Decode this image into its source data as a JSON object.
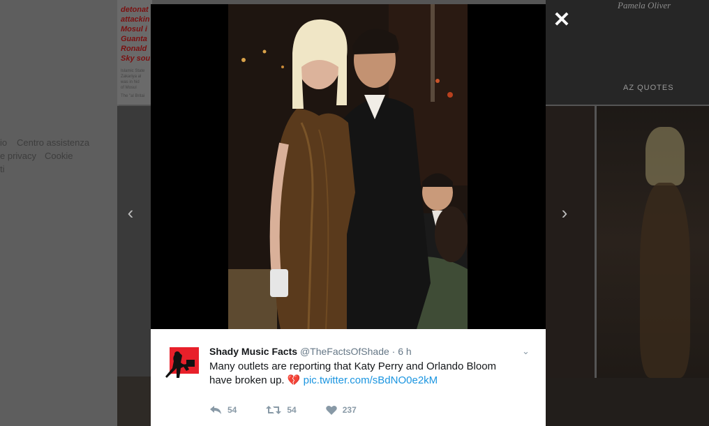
{
  "background": {
    "news_lines": [
      "detonat",
      "attackin",
      "Mosul i",
      "Guanta",
      "Ronald",
      "Sky sou"
    ],
    "news_small": [
      "Islamic State",
      "Zakariya al",
      "was in hid",
      "of Mosul",
      "The \"al Britai"
    ],
    "footer_links": [
      "io",
      "Centro assistenza",
      "e privacy",
      "Cookie",
      "ti"
    ],
    "quote_author": "Pamela Oliver",
    "quote_brand": "AZ QUOTES"
  },
  "gallery": {
    "close_icon": "close-icon",
    "prev_icon": "chevron-left-icon",
    "next_icon": "chevron-right-icon",
    "close_glyph": "✕",
    "prev_glyph": "‹",
    "next_glyph": "›"
  },
  "tweet": {
    "author_name": "Shady Music Facts",
    "handle": "@TheFactsOfShade",
    "separator": " · ",
    "time": "6 h",
    "text_main": "Many outlets are reporting that Katy Perry and Orlando Bloom have broken up. ",
    "emoji": "💔",
    "link": "pic.twitter.com/sBdNO0e2kM",
    "caret_glyph": "⌄",
    "reply_count": "54",
    "retweet_count": "54",
    "like_count": "237",
    "colors": {
      "link": "#1b95e0",
      "avatar_red": "#e8202a",
      "muted": "#8899a6"
    }
  }
}
